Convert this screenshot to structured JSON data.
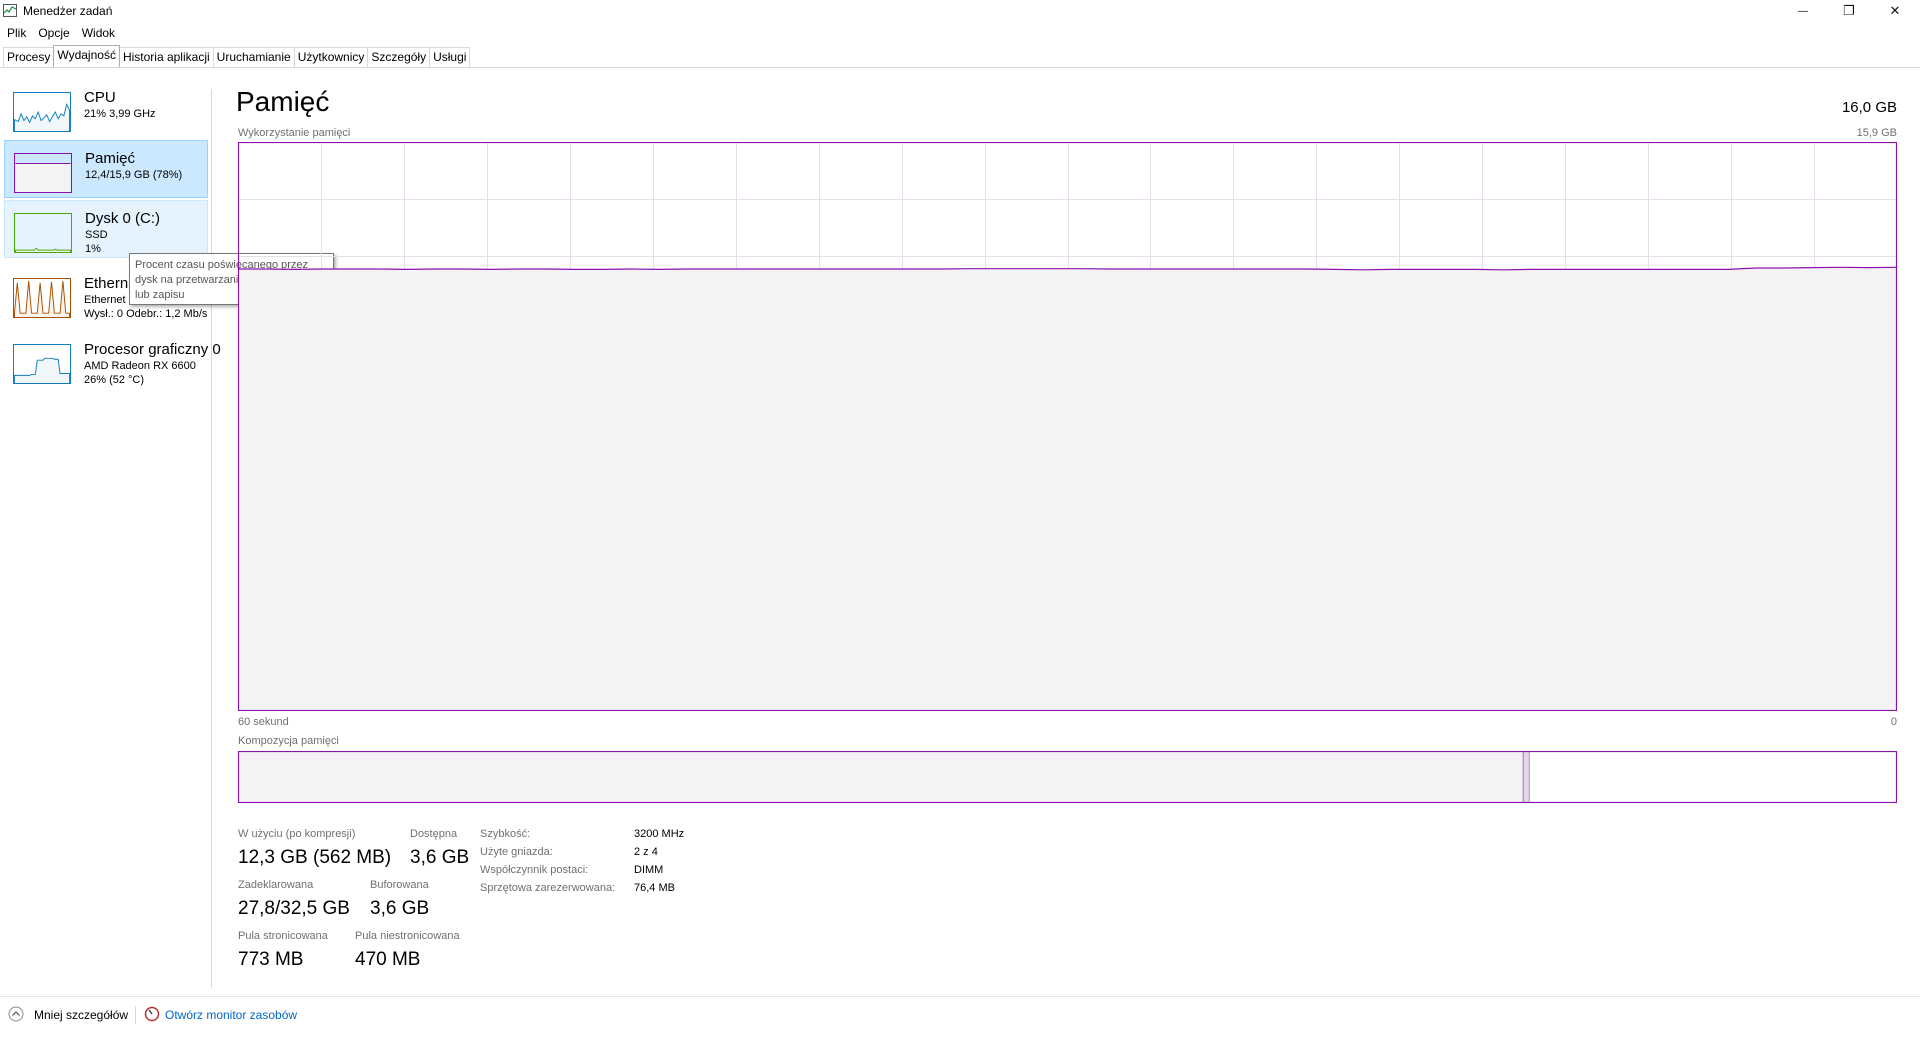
{
  "window": {
    "title": "Menedżer zadań",
    "minimize_glyph": "—",
    "maximize_glyph": "❐",
    "close_glyph": "✕"
  },
  "menu": [
    "Plik",
    "Opcje",
    "Widok"
  ],
  "tabs": [
    {
      "label": "Procesy",
      "active": false
    },
    {
      "label": "Wydajność",
      "active": true
    },
    {
      "label": "Historia aplikacji",
      "active": false
    },
    {
      "label": "Uruchamianie",
      "active": false
    },
    {
      "label": "Użytkownicy",
      "active": false
    },
    {
      "label": "Szczegóły",
      "active": false
    },
    {
      "label": "Usługi",
      "active": false
    }
  ],
  "sidebar": {
    "items": [
      {
        "title": "CPU",
        "lines": [
          "21% 3,99 GHz"
        ],
        "color": "#117dbb"
      },
      {
        "title": "Pamięć",
        "lines": [
          "12,4/15,9 GB (78%)"
        ],
        "color": "#8b12ae"
      },
      {
        "title": "Dysk 0 (C:)",
        "lines": [
          "SSD",
          "1%"
        ],
        "color": "#4da60c"
      },
      {
        "title": "Ethernet",
        "lines": [
          "Ethernet",
          "Wysł.: 0 Odebr.: 1,2 Mb/s"
        ],
        "color": "#a74f01"
      },
      {
        "title": "Procesor graficzny 0",
        "lines": [
          "AMD Radeon RX 6600",
          "26% (52 °C)"
        ],
        "color": "#117dbb"
      }
    ]
  },
  "tooltip": {
    "lines": [
      "Procent czasu poświęcanego przez",
      "dysk na przetwarzanie żądań odczytu",
      "lub zapisu"
    ]
  },
  "main": {
    "title": "Pamięć",
    "total": "16,0 GB",
    "usage_label": "Wykorzystanie pamięci",
    "usage_max": "15,9 GB",
    "time_left": "60 sekund",
    "time_right": "0",
    "composition_label": "Kompozycja pamięci",
    "accent_color": "#8b12ae",
    "fill_color": "#f4f2f4"
  },
  "chart_data": {
    "type": "area",
    "ylabel": "Wykorzystanie pamięci",
    "ylim": [
      0,
      15.9
    ],
    "xlabel": "",
    "x_range_label": [
      "60 sekund",
      "0"
    ],
    "grid": true,
    "values": [
      12.35,
      12.35,
      12.34,
      12.35,
      12.35,
      12.35,
      12.34,
      12.35,
      12.35,
      12.34,
      12.35,
      12.35,
      12.34,
      12.34,
      12.35,
      12.34,
      12.35,
      12.35,
      12.35,
      12.35,
      12.35,
      12.35,
      12.35,
      12.35,
      12.35,
      12.35,
      12.36,
      12.36,
      12.36,
      12.36,
      12.36,
      12.35,
      12.35,
      12.35,
      12.35,
      12.35,
      12.35,
      12.35,
      12.35,
      12.34,
      12.33,
      12.34,
      12.34,
      12.34,
      12.34,
      12.33,
      12.34,
      12.34,
      12.34,
      12.34,
      12.34,
      12.34,
      12.34,
      12.34,
      12.38,
      12.38,
      12.39,
      12.4,
      12.39,
      12.4
    ]
  },
  "composition": {
    "in_use_fraction": 0.775,
    "modified_fraction": 0.003,
    "standby_fraction": 0.222
  },
  "stats": {
    "in_use_label": "W użyciu (po kompresji)",
    "in_use_value": "12,3 GB (562 MB)",
    "available_label": "Dostępna",
    "available_value": "3,6 GB",
    "committed_label": "Zadeklarowana",
    "committed_value": "27,8/32,5 GB",
    "cached_label": "Buforowana",
    "cached_value": "3,6 GB",
    "paged_label": "Pula stronicowana",
    "paged_value": "773 MB",
    "nonpaged_label": "Pula niestronicowana",
    "nonpaged_value": "470 MB"
  },
  "details": {
    "speed_label": "Szybkość:",
    "speed_value": "3200 MHz",
    "slots_label": "Użyte gniazda:",
    "slots_value": "2 z 4",
    "form_label": "Współczynnik postaci:",
    "form_value": "DIMM",
    "reserved_label": "Sprzętowa zarezerwowana:",
    "reserved_value": "76,4 MB"
  },
  "footer": {
    "fewer_details": "Mniej szczegółów",
    "open_monitor": "Otwórz monitor zasobów"
  }
}
